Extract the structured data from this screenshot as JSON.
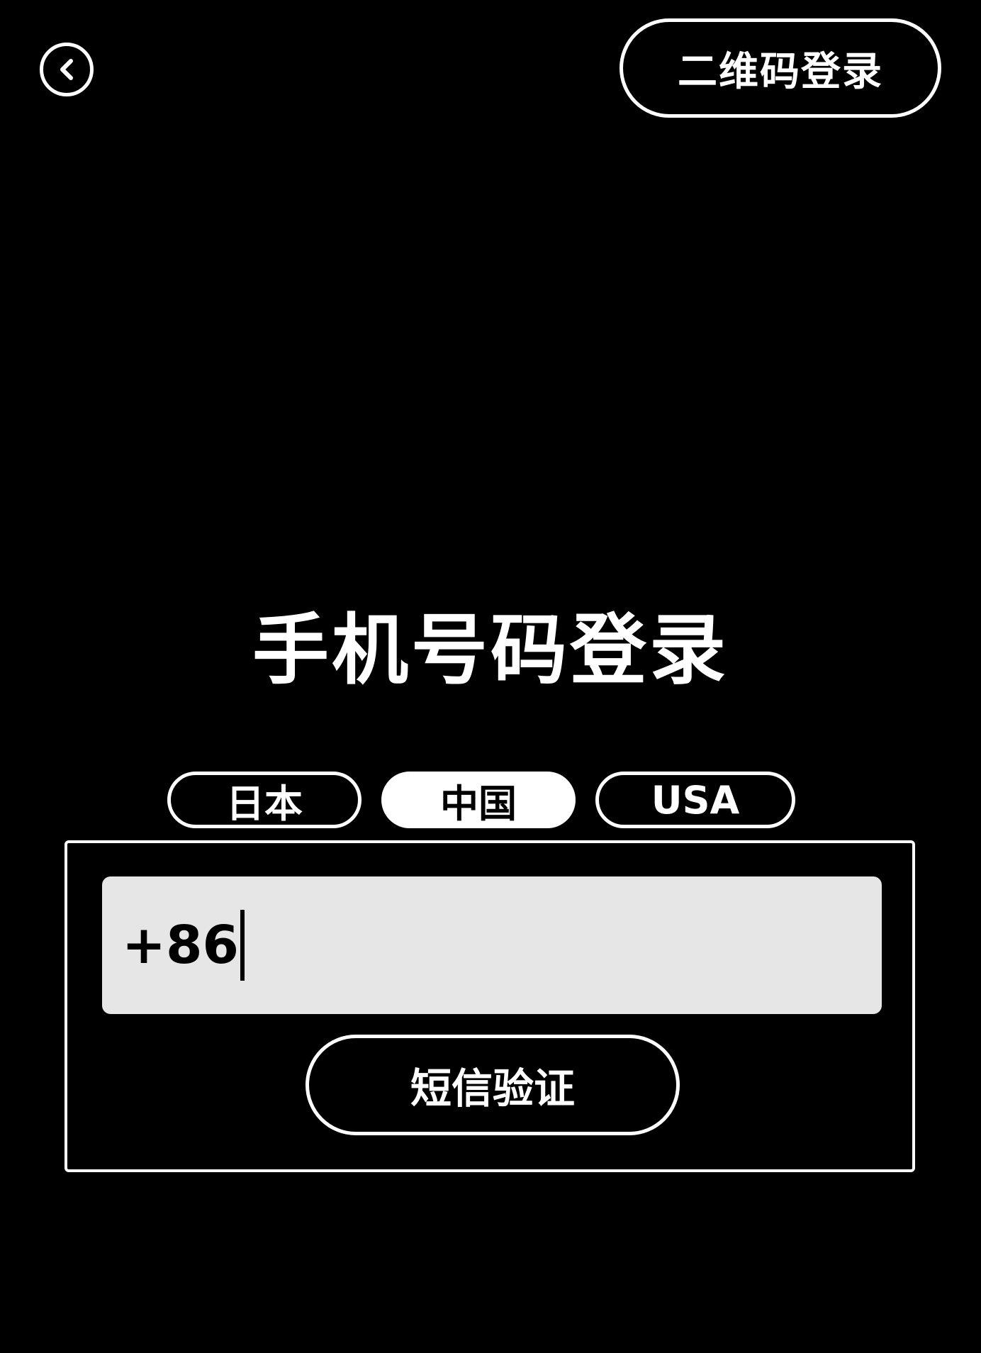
{
  "header": {
    "back_icon": "chevron-left-circle-icon",
    "qr_login_label": "二维码登录"
  },
  "title": "手机号码登录",
  "region_tabs": [
    {
      "label": "日本",
      "selected": false
    },
    {
      "label": "中国",
      "selected": true
    },
    {
      "label": "USA",
      "selected": false
    }
  ],
  "phone_input": {
    "value": "+86"
  },
  "sms_button_label": "短信验证",
  "colors": {
    "background": "#000000",
    "foreground": "#ffffff",
    "input_background": "#e6e6e6",
    "input_text": "#000000"
  }
}
